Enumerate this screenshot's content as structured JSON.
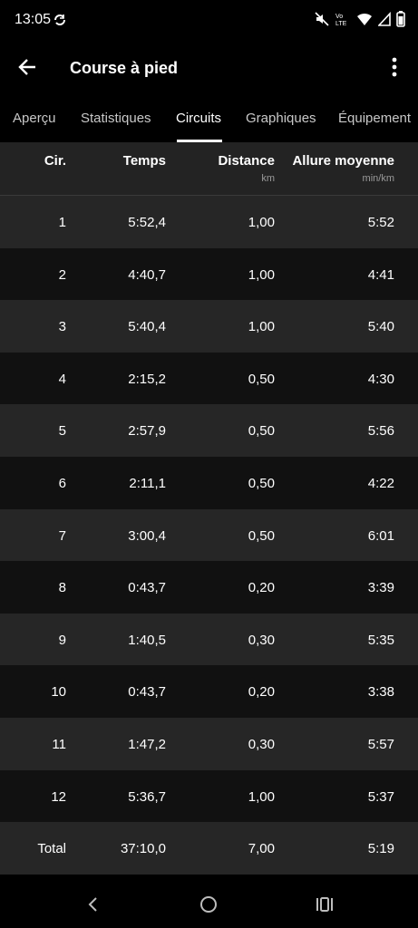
{
  "status_bar": {
    "time": "13:05",
    "icons": [
      "sync-icon",
      "mute-icon",
      "volte-icon",
      "wifi-icon",
      "signal-icon",
      "battery-icon"
    ]
  },
  "app_bar": {
    "title": "Course à pied",
    "icons": [
      "back-arrow-icon",
      "more-vert-icon"
    ]
  },
  "tabs": [
    {
      "label": "Aperçu",
      "active": false
    },
    {
      "label": "Statistiques",
      "active": false
    },
    {
      "label": "Circuits",
      "active": true
    },
    {
      "label": "Graphiques",
      "active": false
    },
    {
      "label": "Équipement",
      "active": false
    }
  ],
  "table": {
    "headers": [
      {
        "label": "Cir.",
        "unit": ""
      },
      {
        "label": "Temps",
        "unit": ""
      },
      {
        "label": "Distance",
        "unit": "km"
      },
      {
        "label": "Allure moyenne",
        "unit": "min/km"
      }
    ],
    "rows": [
      [
        "1",
        "5:52,4",
        "1,00",
        "5:52"
      ],
      [
        "2",
        "4:40,7",
        "1,00",
        "4:41"
      ],
      [
        "3",
        "5:40,4",
        "1,00",
        "5:40"
      ],
      [
        "4",
        "2:15,2",
        "0,50",
        "4:30"
      ],
      [
        "5",
        "2:57,9",
        "0,50",
        "5:56"
      ],
      [
        "6",
        "2:11,1",
        "0,50",
        "4:22"
      ],
      [
        "7",
        "3:00,4",
        "0,50",
        "6:01"
      ],
      [
        "8",
        "0:43,7",
        "0,20",
        "3:39"
      ],
      [
        "9",
        "1:40,5",
        "0,30",
        "5:35"
      ],
      [
        "10",
        "0:43,7",
        "0,20",
        "3:38"
      ],
      [
        "11",
        "1:47,2",
        "0,30",
        "5:57"
      ],
      [
        "12",
        "5:36,7",
        "1,00",
        "5:37"
      ]
    ],
    "total": [
      "Total",
      "37:10,0",
      "7,00",
      "5:19"
    ]
  },
  "nav_bar": {
    "icons": [
      "nav-back-icon",
      "nav-home-icon",
      "nav-recents-icon"
    ]
  },
  "colors": {
    "background": "#000000",
    "row_light": "#262626",
    "row_dark": "#111111",
    "text": "#ffffff",
    "muted": "#9a9a9a"
  }
}
